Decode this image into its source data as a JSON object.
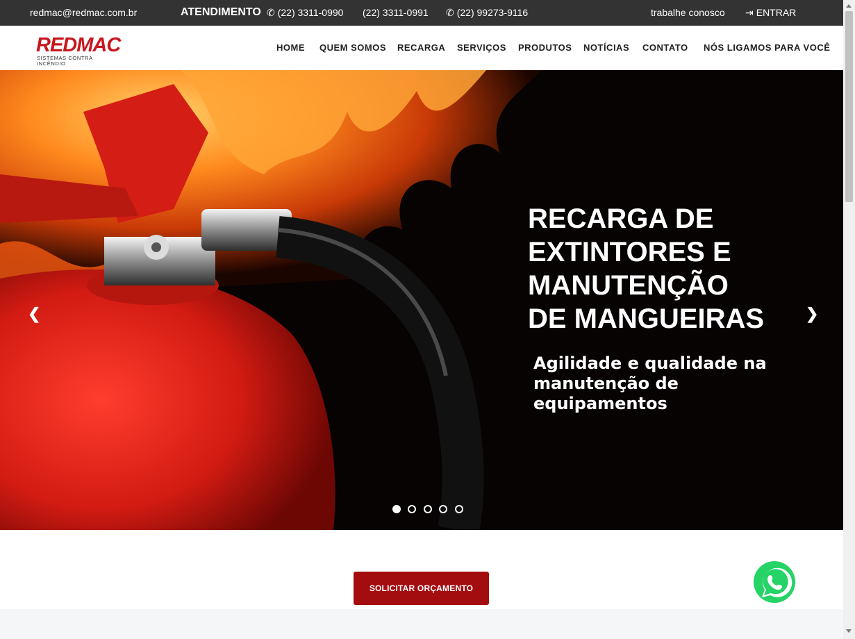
{
  "topbar": {
    "email": "redmac@redmac.com.br",
    "atendimento_label": "ATENDIMENTO",
    "phone1": "(22) 3311-0990",
    "phone2": "(22) 3311-0991",
    "whatsapp_phone": "(22) 99273-9116",
    "work_with_us": "trabalhe conosco",
    "login": "ENTRAR"
  },
  "brand": {
    "logo_text": "REDMAC",
    "logo_subtitle": "SISTEMAS CONTRA INCÊNDIO",
    "color": "#c8171e"
  },
  "nav": {
    "items": [
      "HOME",
      "QUEM SOMOS",
      "RECARGA",
      "SERVIÇOS",
      "PRODUTOS",
      "NOTÍCIAS",
      "CONTATO",
      "NÓS LIGAMOS PARA VOCÊ"
    ]
  },
  "hero": {
    "title": "RECARGA DE\nEXTINTORES E\nMANUTENÇÃO\nDE MANGUEIRAS",
    "subtitle": "Agilidade e qualidade na\nmanutenção de\nequipamentos",
    "prev_icon": "chevron-left-icon",
    "next_icon": "chevron-right-icon",
    "slides_count": 5,
    "active_slide": 1
  },
  "cta": {
    "label": "SOLICITAR ORÇAMENTO",
    "color": "#a40d10"
  },
  "whatsapp": {
    "icon": "whatsapp-icon",
    "color": "#25d366"
  }
}
